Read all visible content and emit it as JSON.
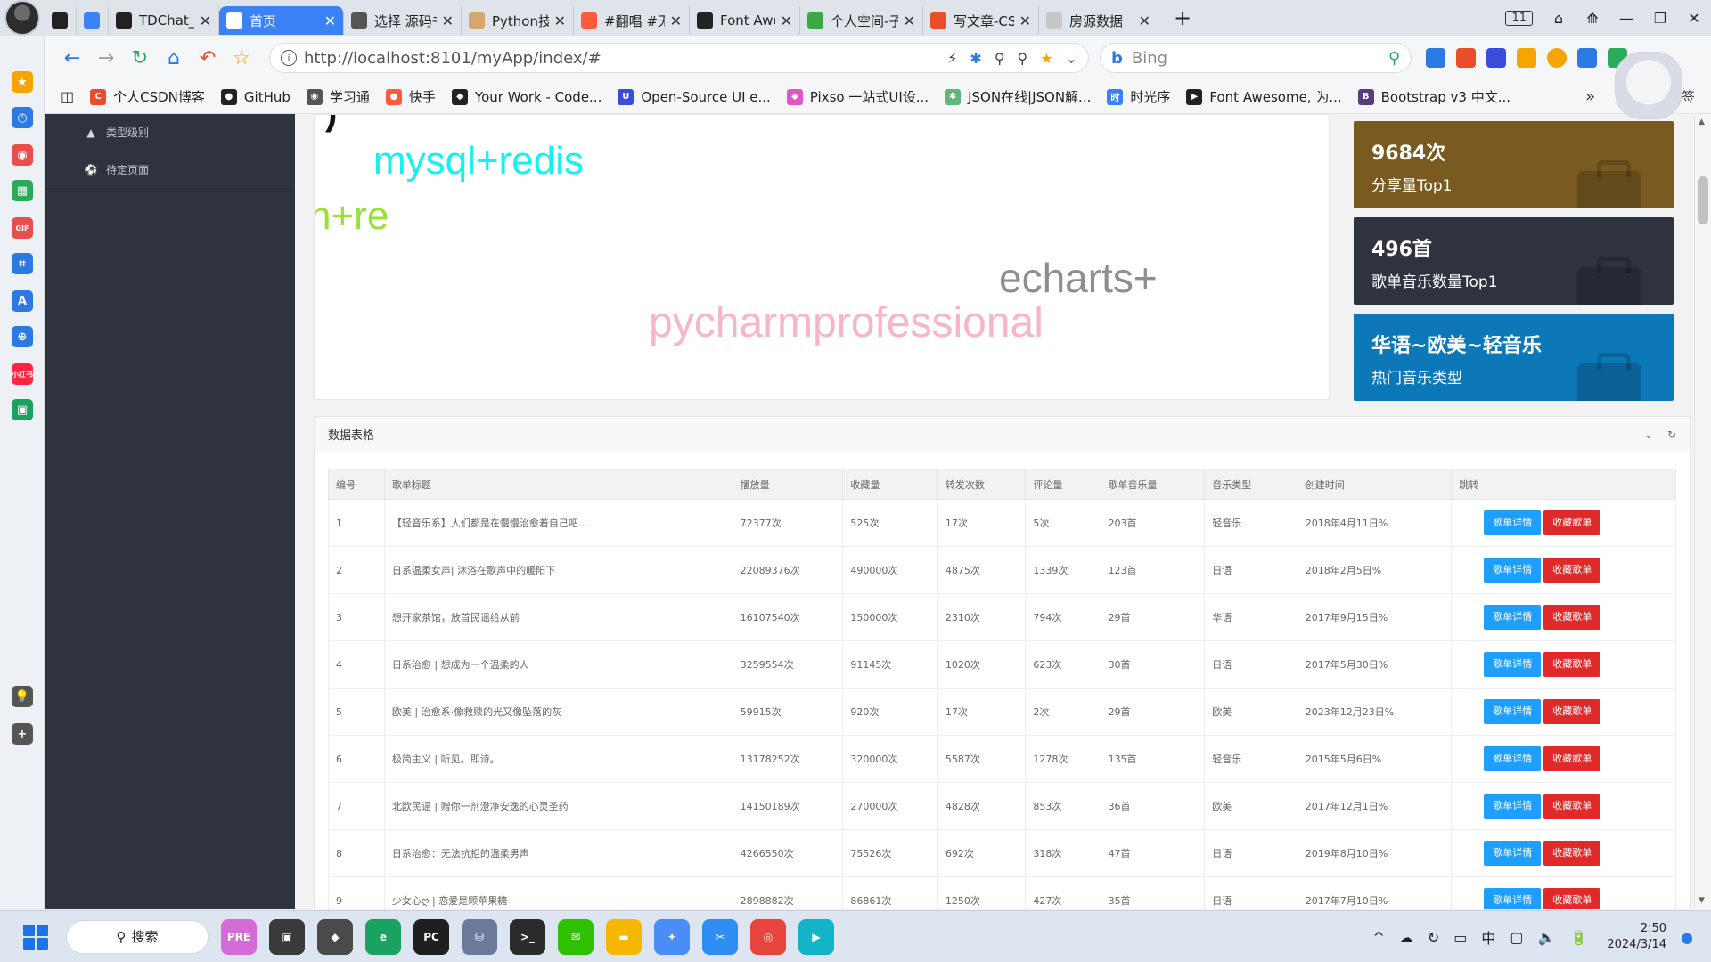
{
  "browser": {
    "tabs": [
      {
        "label": "",
        "favicon_color": "#222222",
        "active": false
      },
      {
        "label": "",
        "favicon_color": "#3b82f6",
        "active": false
      },
      {
        "label": "TDChat_GP",
        "favicon_color": "#222222",
        "active": false
      },
      {
        "label": "首页",
        "favicon_color": "#ffffff",
        "active": true
      },
      {
        "label": "选择 源码书",
        "favicon_color": "#555555",
        "active": false
      },
      {
        "label": "Python技术",
        "favicon_color": "#d7a86e",
        "active": false
      },
      {
        "label": "#翻唱 #无声",
        "favicon_color": "#ff5a3c",
        "active": false
      },
      {
        "label": "Font Awes",
        "favicon_color": "#222222",
        "active": false
      },
      {
        "label": "个人空间-子",
        "favicon_color": "#3ca845",
        "active": false
      },
      {
        "label": "写文章-CSD",
        "favicon_color": "#e94e2a",
        "active": false
      },
      {
        "label": "房源数据",
        "favicon_color": "#c7c7c7",
        "active": false
      }
    ],
    "new_tab": "+",
    "tab_count": "11",
    "window_controls": [
      "⌂",
      "⟰",
      "—",
      "❐",
      "✕"
    ],
    "url": "http://localhost:8101/myApp/index/#",
    "search_placeholder": "Bing",
    "search_brand": "b",
    "bookmarks": [
      {
        "label": "个人CSDN博客",
        "color": "#e94e2a",
        "glyph": "C"
      },
      {
        "label": "GitHub",
        "color": "#222222",
        "glyph": "●"
      },
      {
        "label": "学习通",
        "color": "#555555",
        "glyph": "◉"
      },
      {
        "label": "快手",
        "color": "#ff5a3c",
        "glyph": "●"
      },
      {
        "label": "Your Work - Code...",
        "color": "#222222",
        "glyph": "◆"
      },
      {
        "label": "Open-Source UI e...",
        "color": "#3b4bdb",
        "glyph": "U"
      },
      {
        "label": "Pixso 一站式UI设...",
        "color": "#e255c8",
        "glyph": "◆"
      },
      {
        "label": "JSON在线|JSON解...",
        "color": "#5fb878",
        "glyph": "✱"
      },
      {
        "label": "时光序",
        "color": "#3b82f6",
        "glyph": "时"
      },
      {
        "label": "Font Awesome, 为...",
        "color": "#222222",
        "glyph": "▶"
      },
      {
        "label": "Bootstrap v3 中文...",
        "color": "#563d7c",
        "glyph": "B"
      }
    ],
    "bookmarks_more": "»",
    "bookmarks_last": "签"
  },
  "sidebar": {
    "items": [
      {
        "label": "类型级别",
        "icon": "graduation-cap-icon"
      },
      {
        "label": "待定页面",
        "icon": "soccer-ball-icon"
      }
    ]
  },
  "wordcloud": {
    "words": [
      {
        "text": ")",
        "color": "#111111"
      },
      {
        "text": "mysql+redis",
        "color": "#14f1f1"
      },
      {
        "text": "n+re",
        "color": "#99e233"
      },
      {
        "text": "echarts+",
        "color": "#8e8e8e"
      },
      {
        "text": "pycharmprofessional",
        "color": "#f7b6c6"
      }
    ]
  },
  "cards": [
    {
      "value": "9684次",
      "label": "分享量Top1",
      "color": "#795b22"
    },
    {
      "value": "496首",
      "label": "歌单音乐数量Top1",
      "color": "#2f3340"
    },
    {
      "value": "华语~欧美~轻音乐",
      "label": "热门音乐类型",
      "color": "#0d78b8"
    }
  ],
  "table_panel": {
    "title": "数据表格",
    "icons": [
      "chevron-down-icon",
      "refresh-icon"
    ]
  },
  "table": {
    "columns": [
      "编号",
      "歌单标题",
      "播放量",
      "收藏量",
      "转发次数",
      "评论量",
      "歌单音乐量",
      "音乐类型",
      "创建时间",
      "跳转"
    ],
    "detail_label": "歌单详情",
    "fav_label": "收藏歌单",
    "rows": [
      [
        "1",
        "【轻音乐系】人们都是在慢慢治愈着自己吧...",
        "72377次",
        "525次",
        "17次",
        "5次",
        "203首",
        "轻音乐",
        "2018年4月11日%"
      ],
      [
        "2",
        "日系温柔女声| 沐浴在歌声中的暖阳下",
        "22089376次",
        "490000次",
        "4875次",
        "1339次",
        "123首",
        "日语",
        "2018年2月5日%"
      ],
      [
        "3",
        "想开家茶馆，放首民谣给从前",
        "16107540次",
        "150000次",
        "2310次",
        "794次",
        "29首",
        "华语",
        "2017年9月15日%"
      ],
      [
        "4",
        "日系治愈 | 想成为一个温柔的人",
        "3259554次",
        "91145次",
        "1020次",
        "623次",
        "30首",
        "日语",
        "2017年5月30日%"
      ],
      [
        "5",
        "欧美 | 治愈系·像救赎的光又像坠落的灰",
        "59915次",
        "920次",
        "17次",
        "2次",
        "29首",
        "欧美",
        "2023年12月23日%"
      ],
      [
        "6",
        "极简主义 | 听见。即诗。",
        "13178252次",
        "320000次",
        "5587次",
        "1278次",
        "135首",
        "轻音乐",
        "2015年5月6日%"
      ],
      [
        "7",
        "北欧民谣 | 赠你一剂澄净安逸的心灵圣药",
        "14150189次",
        "270000次",
        "4828次",
        "853次",
        "36首",
        "欧美",
        "2017年12月1日%"
      ],
      [
        "8",
        "日系治愈：无法抗拒的温柔男声",
        "4266550次",
        "75526次",
        "692次",
        "318次",
        "47首",
        "日语",
        "2019年8月10日%"
      ],
      [
        "9",
        "少女心ღ | 恋爱是颗苹果糖",
        "2898882次",
        "86861次",
        "1250次",
        "427次",
        "35首",
        "日语",
        "2017年7月10日%"
      ]
    ]
  },
  "taskbar": {
    "search_label": "搜索",
    "apps": [
      {
        "name": "copilot-app",
        "color": "#d46bd6",
        "glyph": "PRE"
      },
      {
        "name": "terminal-window-app",
        "color": "#3a3a3a",
        "glyph": "▣"
      },
      {
        "name": "cube-app",
        "color": "#4a4a4a",
        "glyph": "◆"
      },
      {
        "name": "browser-app",
        "color": "#1aa260",
        "glyph": "e"
      },
      {
        "name": "pycharm-app",
        "color": "#1f1f1f",
        "glyph": "PC"
      },
      {
        "name": "network-app",
        "color": "#6b7a99",
        "glyph": "⛁"
      },
      {
        "name": "cmd-app",
        "color": "#2b2b2b",
        "glyph": ">_"
      },
      {
        "name": "wechat-app",
        "color": "#2dc100",
        "glyph": "✉"
      },
      {
        "name": "folder-app",
        "color": "#f5b700",
        "glyph": "▬"
      },
      {
        "name": "chat-app",
        "color": "#4a8df6",
        "glyph": "✦"
      },
      {
        "name": "screenshot-app",
        "color": "#2f8cf0",
        "glyph": "✂"
      },
      {
        "name": "chrome-app",
        "color": "#e8453c",
        "glyph": "◎"
      },
      {
        "name": "feishu-app",
        "color": "#14b4c8",
        "glyph": "▶"
      }
    ],
    "tray_icons": [
      "^",
      "☁",
      "↻",
      "▭",
      "中",
      "▢",
      "🔈",
      "🔋"
    ],
    "time": "2:50",
    "date": "2024/3/14"
  },
  "left_dock": [
    {
      "name": "favorites-icon",
      "color": "#f7a400",
      "glyph": "★"
    },
    {
      "name": "history-icon",
      "color": "#2b7ae4",
      "glyph": "◷"
    },
    {
      "name": "record-icon",
      "color": "#e94e4e",
      "glyph": "◉"
    },
    {
      "name": "qr-icon",
      "color": "#2bab5a",
      "glyph": "▦"
    },
    {
      "name": "gif-icon",
      "color": "#e94e4e",
      "glyph": "GIF"
    },
    {
      "name": "crop-icon",
      "color": "#2b7ae4",
      "glyph": "⌗"
    },
    {
      "name": "translate-icon",
      "color": "#2b7ae4",
      "glyph": "A"
    },
    {
      "name": "app-icon",
      "color": "#2b7ae4",
      "glyph": "⊕"
    },
    {
      "name": "xiaohongshu-icon",
      "color": "#ff2442",
      "glyph": "小红书"
    },
    {
      "name": "monitor-icon",
      "color": "#1aa260",
      "glyph": "▣"
    },
    {
      "name": "bulb-icon",
      "color": "#555555",
      "glyph": "💡"
    },
    {
      "name": "add-icon",
      "color": "#555555",
      "glyph": "+"
    }
  ]
}
